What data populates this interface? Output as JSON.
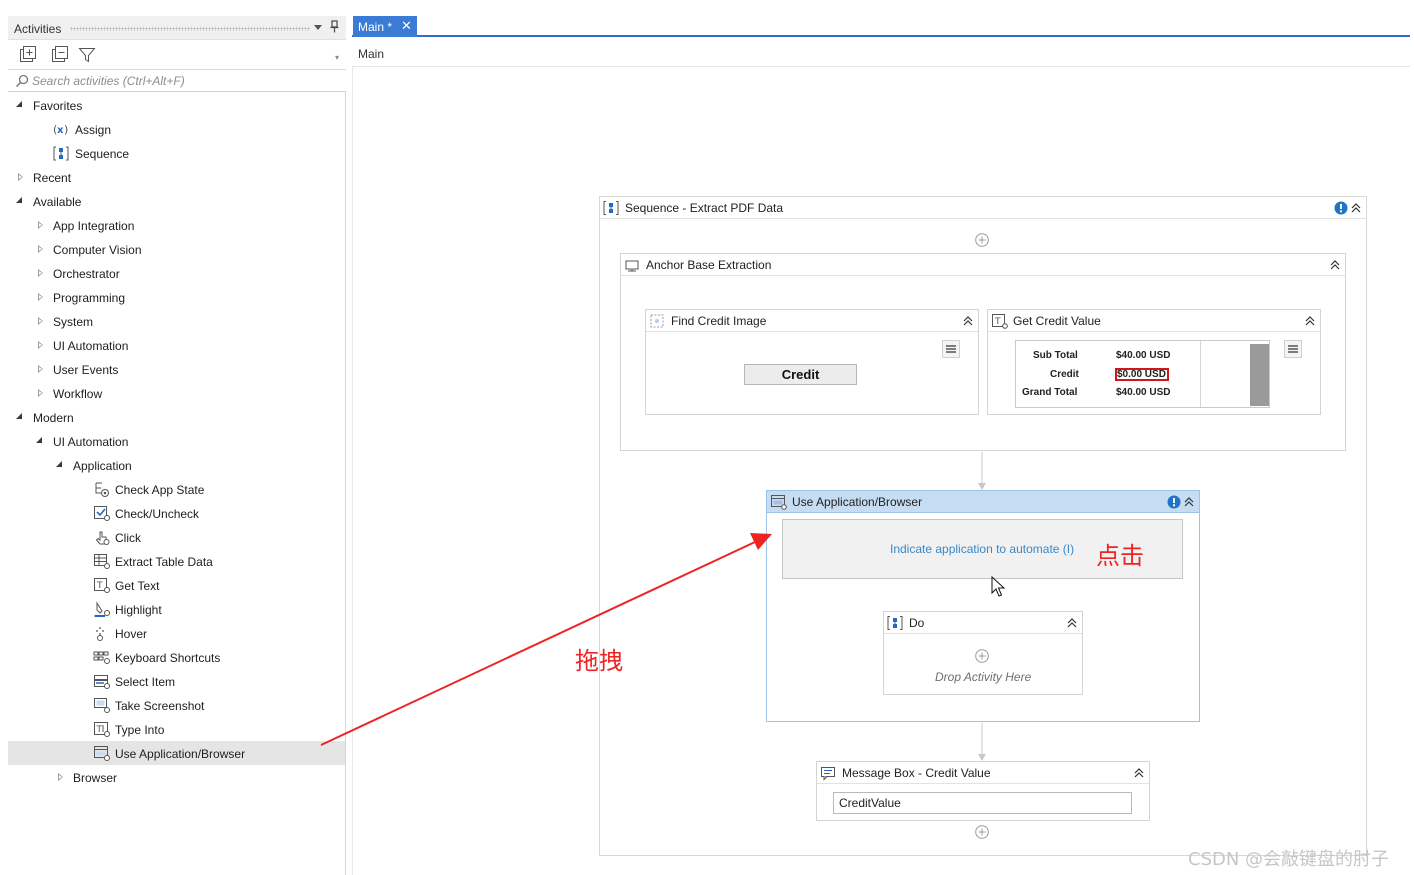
{
  "activities_panel": {
    "title": "Activities",
    "pin_icon": "pin-icon",
    "search_placeholder": "Search activities (Ctrl+Alt+F)",
    "tree": {
      "favorites": {
        "label": "Favorites",
        "items": {
          "assign": "Assign",
          "sequence": "Sequence"
        }
      },
      "recent": "Recent",
      "available": {
        "label": "Available",
        "items": {
          "app_integration": "App Integration",
          "computer_vision": "Computer Vision",
          "orchestrator": "Orchestrator",
          "programming": "Programming",
          "system": "System",
          "ui_automation": "UI Automation",
          "user_events": "User Events",
          "workflow": "Workflow"
        }
      },
      "modern": {
        "label": "Modern",
        "ui_automation": "UI Automation",
        "application": "Application",
        "activities": {
          "check_app_state": "Check App State",
          "check_uncheck": "Check/Uncheck",
          "click": "Click",
          "extract_table_data": "Extract Table Data",
          "get_text": "Get Text",
          "highlight": "Highlight",
          "hover": "Hover",
          "keyboard_shortcuts": "Keyboard Shortcuts",
          "select_item": "Select Item",
          "take_screenshot": "Take Screenshot",
          "type_into": "Type Into",
          "use_application_browser": "Use Application/Browser"
        },
        "browser": "Browser"
      }
    }
  },
  "designer": {
    "tab_label": "Main *",
    "breadcrumb": "Main",
    "sequence": {
      "title": "Sequence - Extract PDF Data",
      "anchor": {
        "title": "Anchor Base Extraction",
        "find_credit_image": {
          "title": "Find Credit Image",
          "button_text": "Credit"
        },
        "get_credit_value": {
          "title": "Get Credit Value",
          "thumbnail": {
            "row1": {
              "label": "Sub Total",
              "value": "$40.00 USD"
            },
            "row2": {
              "label": "Credit",
              "value": "$0.00 USD"
            },
            "row3": {
              "label": "Grand Total",
              "value": "$40.00 USD"
            }
          }
        }
      },
      "use_app": {
        "title": "Use Application/Browser",
        "indicate_text": "Indicate application to automate (I)",
        "do": {
          "title": "Do",
          "drop_hint": "Drop Activity Here"
        }
      },
      "message_box": {
        "title": "Message Box - Credit Value",
        "value": "CreditValue"
      }
    }
  },
  "annotations": {
    "click_label": "点击",
    "drag_label": "拖拽",
    "arrow_color": "#ee2424"
  },
  "watermark": "CSDN @会敲键盘的肘子",
  "colors": {
    "tab_blue": "#3a7bd5",
    "selected_header": "#c5dcf2",
    "link_blue": "#3a88c8",
    "info_blue": "#1f74c8"
  }
}
